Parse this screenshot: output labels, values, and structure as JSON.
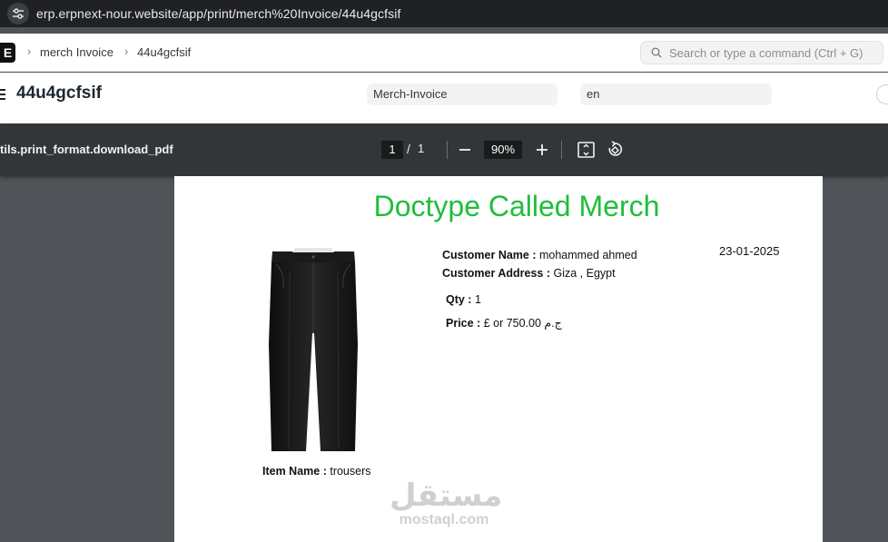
{
  "browser": {
    "url": "erp.erpnext-nour.website/app/print/merch%20Invoice/44u4gcfsif"
  },
  "navbar": {
    "logo_letter": "E",
    "breadcrumbs": [
      "merch Invoice",
      "44u4gcfsif"
    ],
    "search_placeholder": "Search or type a command (Ctrl + G)"
  },
  "page_head": {
    "title": "44u4gcfsif",
    "print_format": "Merch-Invoice",
    "language": "en"
  },
  "pdf_toolbar": {
    "title": "tils.print_format.download_pdf",
    "current_page": "1",
    "page_separator": "/",
    "total_pages": "1",
    "zoom": "90%"
  },
  "document": {
    "title": "Doctype Called Merch",
    "title_color": "#1fbe3b",
    "date": "23-01-2025",
    "customer_name_label": "Customer Name :",
    "customer_name": "mohammed ahmed",
    "customer_address_label": "Customer Address :",
    "customer_address": "Giza , Egypt",
    "qty_label": "Qty :",
    "qty": "1",
    "price_label": "Price :",
    "price": "£ or 750.00 ج.م",
    "item_name_label": "Item Name :",
    "item_name": "trousers",
    "item_image": "black-trousers"
  },
  "watermark": {
    "arabic": "مستقل",
    "latin": "mostaql.com"
  }
}
